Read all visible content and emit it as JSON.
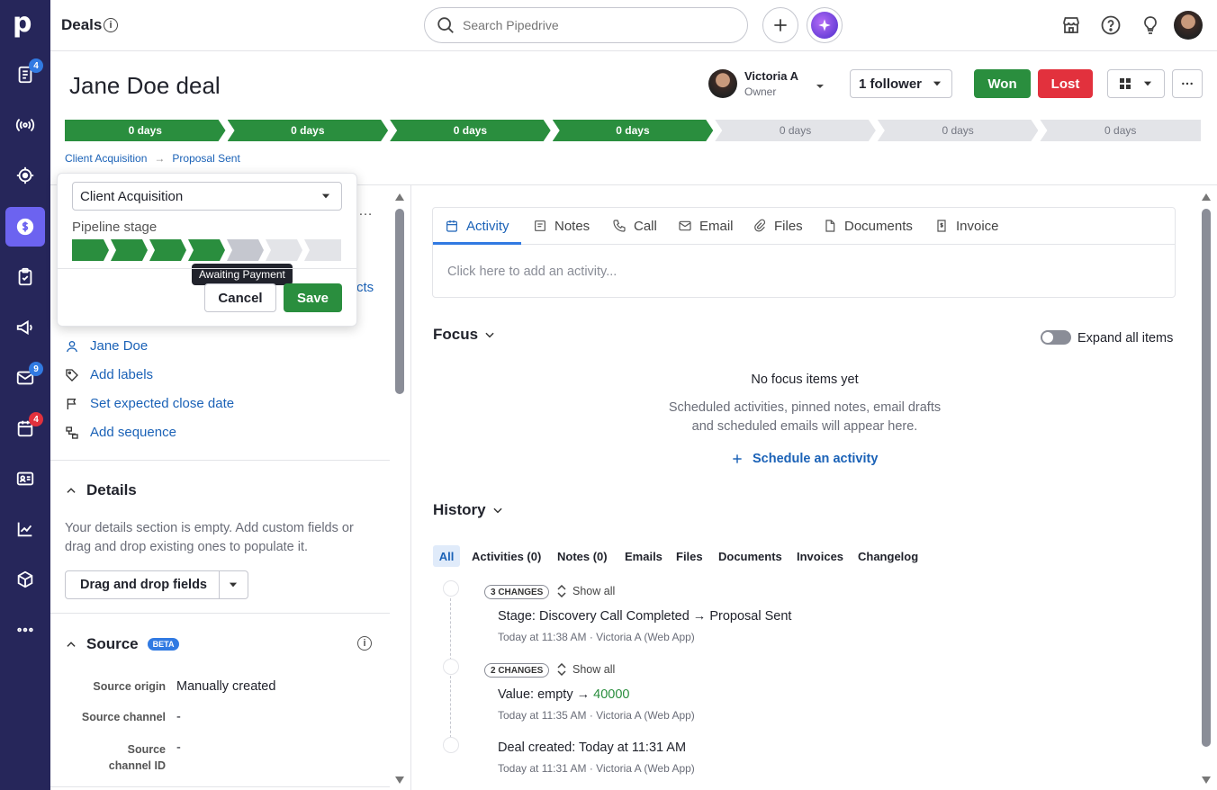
{
  "topbar": {
    "title": "Deals",
    "search_placeholder": "Search Pipedrive"
  },
  "rail": {
    "badges": {
      "deals_list": "4",
      "mail": "9",
      "calendar": "4"
    }
  },
  "deal": {
    "title": "Jane Doe deal",
    "owner_name": "Victoria A",
    "owner_role": "Owner",
    "follower_label": "1 follower",
    "won_label": "Won",
    "lost_label": "Lost",
    "stages": [
      "0 days",
      "0 days",
      "0 days",
      "0 days",
      "0 days",
      "0 days",
      "0 days"
    ],
    "breadcrumb_pipeline": "Client Acquisition",
    "breadcrumb_stage": "Proposal Sent"
  },
  "popover": {
    "pipeline_value": "Client Acquisition",
    "stage_label": "Pipeline stage",
    "tooltip": "Awaiting Payment",
    "cancel_label": "Cancel",
    "save_label": "Save",
    "completed_segments": 4,
    "total_segments": 7
  },
  "sidebar": {
    "hidden_text": "cts",
    "person": "Jane Doe",
    "add_labels": "Add labels",
    "close_date": "Set expected close date",
    "add_sequence": "Add sequence",
    "details_title": "Details",
    "details_empty": "Your details section is empty. Add custom fields or drag and drop existing ones to populate it.",
    "drag_button": "Drag and drop fields",
    "source_title": "Source",
    "source_badge": "BETA",
    "source_rows": [
      {
        "label": "Source origin",
        "value": "Manually created"
      },
      {
        "label": "Source channel",
        "value": "-"
      },
      {
        "label": "Source channel ID",
        "value": "-"
      }
    ]
  },
  "main": {
    "tabs": [
      "Activity",
      "Notes",
      "Call",
      "Email",
      "Files",
      "Documents",
      "Invoice"
    ],
    "activity_placeholder": "Click here to add an activity...",
    "focus_title": "Focus",
    "expand_all": "Expand all items",
    "no_focus": "No focus items yet",
    "focus_desc_1": "Scheduled activities, pinned notes, email drafts",
    "focus_desc_2": "and scheduled emails will appear here.",
    "schedule_link": "Schedule an activity",
    "history_title": "History",
    "history_tabs": [
      "All",
      "Activities (0)",
      "Notes (0)",
      "Emails",
      "Files",
      "Documents",
      "Invoices",
      "Changelog"
    ],
    "history": [
      {
        "changes": "3 CHANGES",
        "show_all": "Show all",
        "label": "Stage",
        "text": "Discovery Call Completed → Proposal Sent",
        "meta": "Today at 11:38 AM · Victoria A (Web App)"
      },
      {
        "changes": "2 CHANGES",
        "show_all": "Show all",
        "label": "Value",
        "text": "empty →",
        "value": "40000",
        "meta": "Today at 11:35 AM · Victoria A (Web App)"
      },
      {
        "label": "Deal created",
        "text": "Today at 11:31 AM",
        "meta": "Today at 11:31 AM · Victoria A (Web App)"
      }
    ]
  },
  "colors": {
    "rail": "#26265a",
    "accent": "#6c63f0",
    "won": "#2a8e3e",
    "lost": "#e2313d",
    "link": "#1b62b7"
  }
}
